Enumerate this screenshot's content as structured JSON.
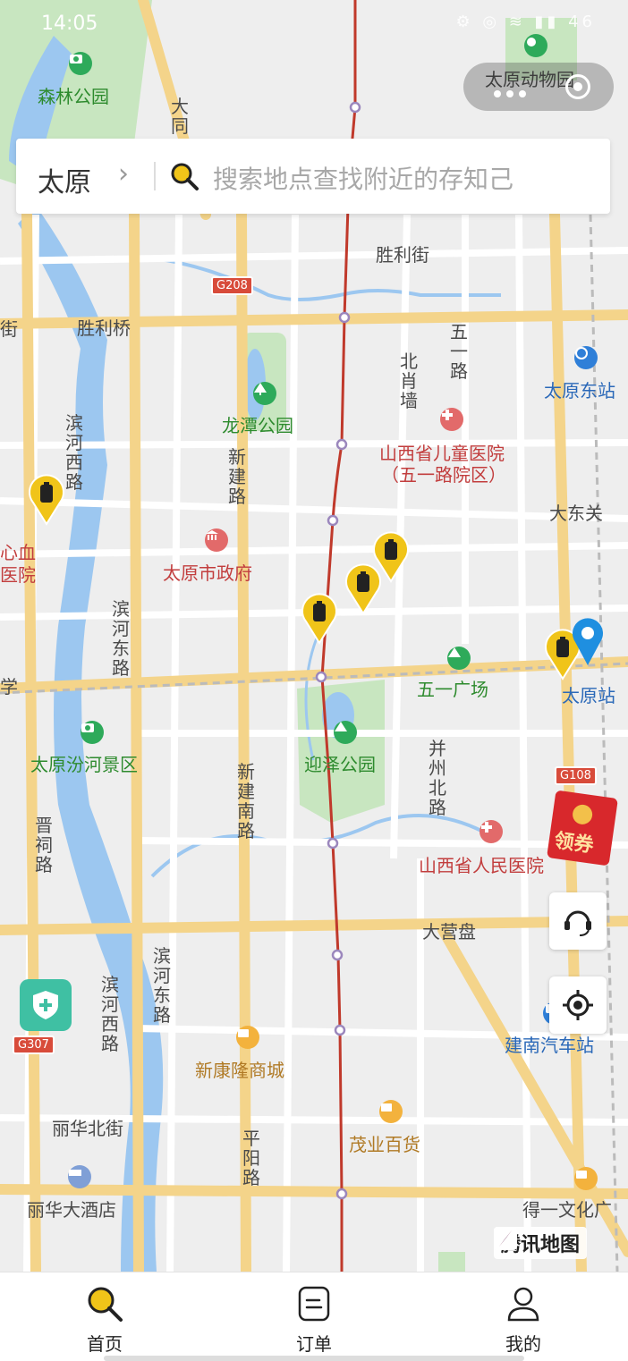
{
  "status_bar": {
    "time": "14:05",
    "icons": "⚙ ◎ ≋ ▮▮ 46"
  },
  "search": {
    "city": "太原",
    "chevron": "›",
    "placeholder": "搜索地点查找附近的存知己"
  },
  "map_labels": {
    "forest_park": "森林公园",
    "datong_road": "大同",
    "zoo": "太原动物园",
    "shengli_street": "胜利街",
    "g208": "G208",
    "jie_left": "街",
    "shengli_bridge": "胜利桥",
    "wuyi_road": "五一路",
    "beixiaoqiang": "北肖墙",
    "taiyuan_east": "太原东站",
    "longtan_park": "龙潭公园",
    "children_hospital": "山西省儿童医院",
    "children_hospital_sub": "（五一路院区）",
    "binhe_west_1": "滨河西路",
    "xinjian_road": "新建路",
    "dadongguan": "大东关",
    "heart_hospital_1": "心血",
    "heart_hospital_2": "医院",
    "city_gov": "太原市政府",
    "binhe_east_1": "滨河东路",
    "xue": "学",
    "wuyi_square": "五一广场",
    "taiyuan_station": "太原站",
    "fenhe_scenic": "太原汾河景区",
    "xinjian_south": "新建南路",
    "yingze_park": "迎泽公园",
    "bingzhou_north": "并州北路",
    "g108": "G108",
    "jinci_road": "晋祠路",
    "peoples_hospital": "山西省人民医院",
    "daying_pan": "大营盘",
    "binhe_west_2": "滨河西路",
    "binhe_east_2": "滨河东路",
    "g307": "G307",
    "xinkanglong": "新康隆商城",
    "jiannan_bus": "建南汽车站",
    "lihua_north": "丽华北街",
    "pingyang_road": "平阳路",
    "maoye": "茂业百货",
    "lihua_hotel": "丽华大酒店",
    "deyi_culture": "得一文化广",
    "watermark": "腾讯地图"
  },
  "coupon": {
    "label": "领券"
  },
  "tabs": [
    {
      "label": "首页",
      "icon": "search-icon",
      "active": true
    },
    {
      "label": "订单",
      "icon": "order-icon",
      "active": false
    },
    {
      "label": "我的",
      "icon": "user-icon",
      "active": false
    }
  ],
  "colors": {
    "river": "#9cc7f0",
    "park": "#c8e6c0",
    "main_road": "#f7d98b",
    "rail_line": "#c0392b",
    "accent": "#f0c419",
    "pin_blue": "#1f8fe0"
  }
}
